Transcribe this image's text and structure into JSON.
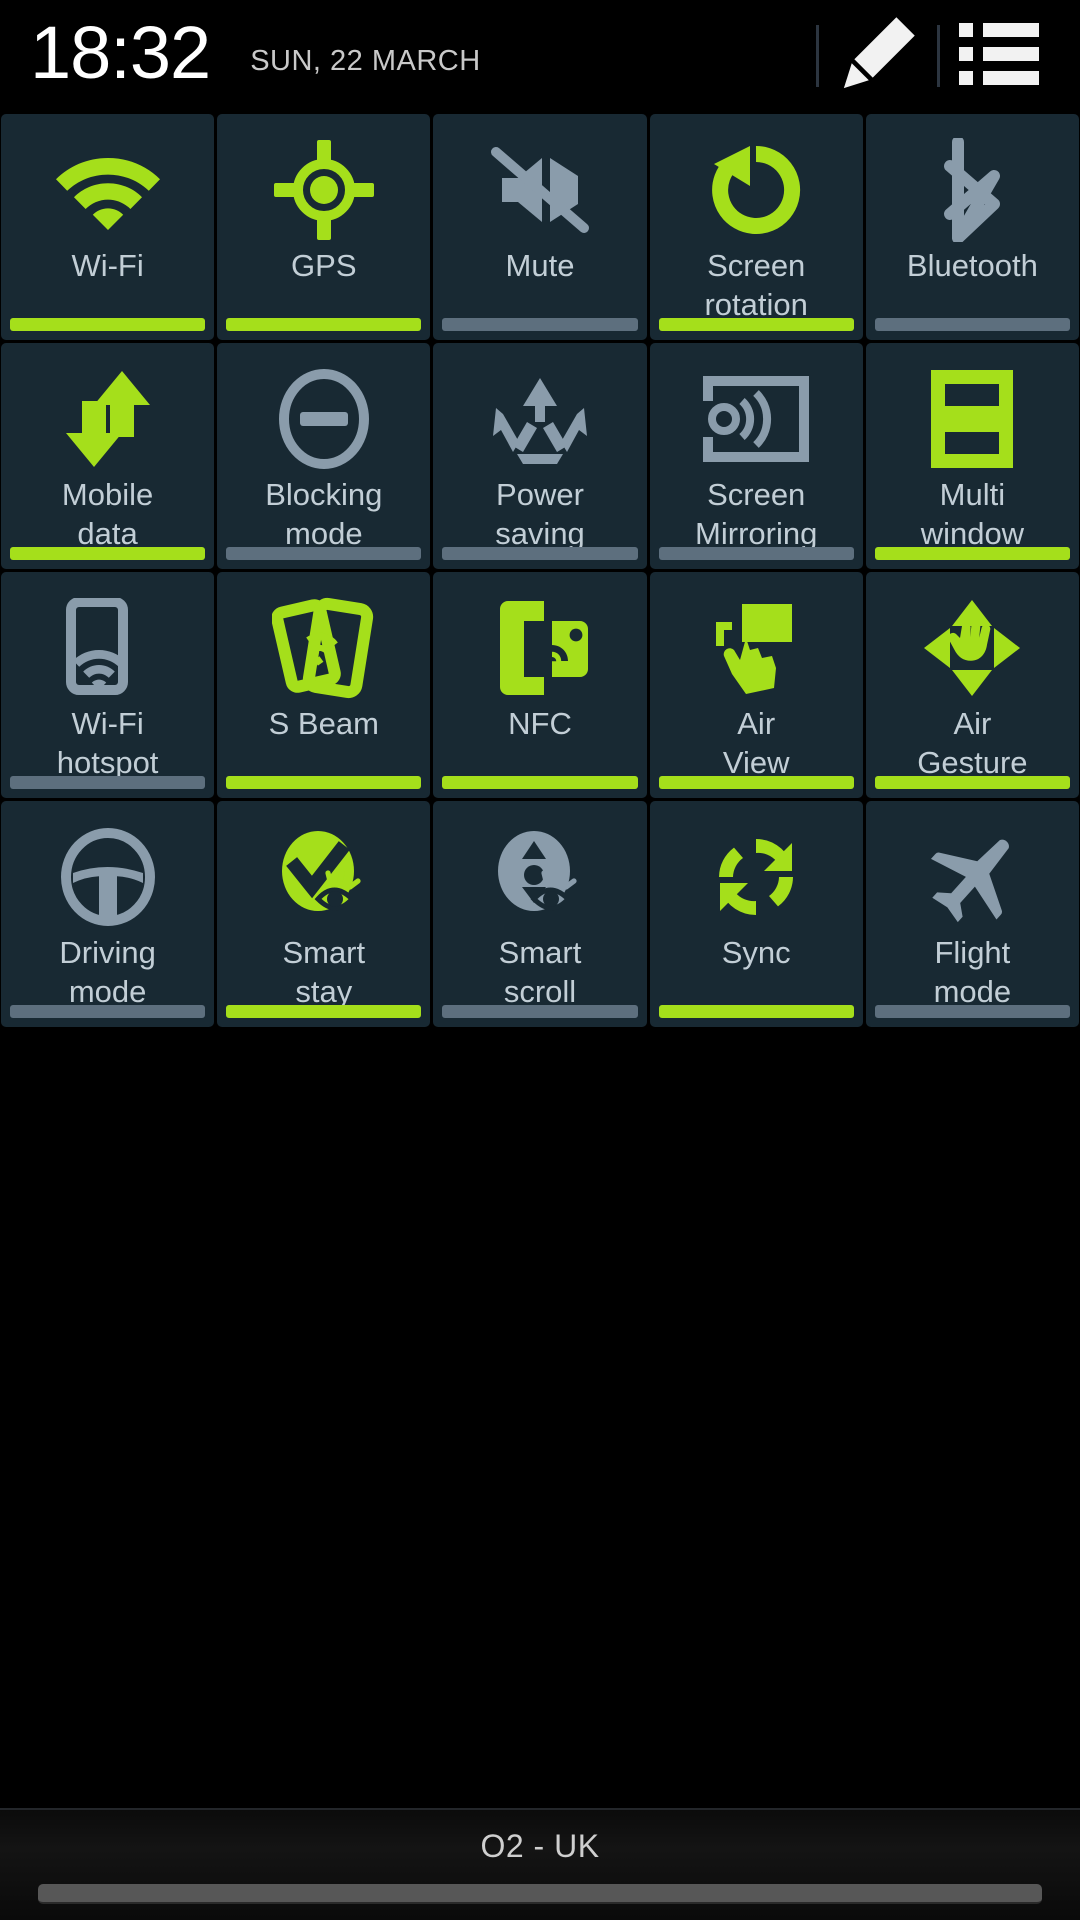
{
  "statusbar": {
    "clock": "18:32",
    "date": "SUN, 22 MARCH",
    "edit_icon": "pencil-icon",
    "list_icon": "list-icon"
  },
  "colors": {
    "active": "#a5df1b",
    "inactive": "#8a9cab",
    "tile_bg": "#182933",
    "label": "#c2ced6",
    "screen_bg": "#000000",
    "bar_inactive": "#5d6f7e"
  },
  "toggles": [
    {
      "label": "Wi-Fi",
      "icon": "wifi-icon",
      "state": "on"
    },
    {
      "label": "GPS",
      "icon": "gps-icon",
      "state": "on"
    },
    {
      "label": "Mute",
      "icon": "mute-icon",
      "state": "off"
    },
    {
      "label": "Screen\nrotation",
      "icon": "screen-rotation-icon",
      "state": "on"
    },
    {
      "label": "Bluetooth",
      "icon": "bluetooth-icon",
      "state": "off"
    },
    {
      "label": "Mobile\ndata",
      "icon": "mobile-data-icon",
      "state": "on"
    },
    {
      "label": "Blocking\nmode",
      "icon": "blocking-mode-icon",
      "state": "off"
    },
    {
      "label": "Power\nsaving",
      "icon": "power-saving-icon",
      "state": "off"
    },
    {
      "label": "Screen\nMirroring",
      "icon": "screen-mirroring-icon",
      "state": "off"
    },
    {
      "label": "Multi\nwindow",
      "icon": "multi-window-icon",
      "state": "on"
    },
    {
      "label": "Wi-Fi\nhotspot",
      "icon": "wifi-hotspot-icon",
      "state": "off"
    },
    {
      "label": "S Beam",
      "icon": "s-beam-icon",
      "state": "on"
    },
    {
      "label": "NFC",
      "icon": "nfc-icon",
      "state": "on"
    },
    {
      "label": "Air\nView",
      "icon": "air-view-icon",
      "state": "on"
    },
    {
      "label": "Air\nGesture",
      "icon": "air-gesture-icon",
      "state": "on"
    },
    {
      "label": "Driving\nmode",
      "icon": "driving-mode-icon",
      "state": "off"
    },
    {
      "label": "Smart\nstay",
      "icon": "smart-stay-icon",
      "state": "on"
    },
    {
      "label": "Smart\nscroll",
      "icon": "smart-scroll-icon",
      "state": "off"
    },
    {
      "label": "Sync",
      "icon": "sync-icon",
      "state": "on"
    },
    {
      "label": "Flight\nmode",
      "icon": "flight-mode-icon",
      "state": "off"
    }
  ],
  "footer": {
    "carrier": "O2 - UK",
    "handle": "drag-handle"
  }
}
